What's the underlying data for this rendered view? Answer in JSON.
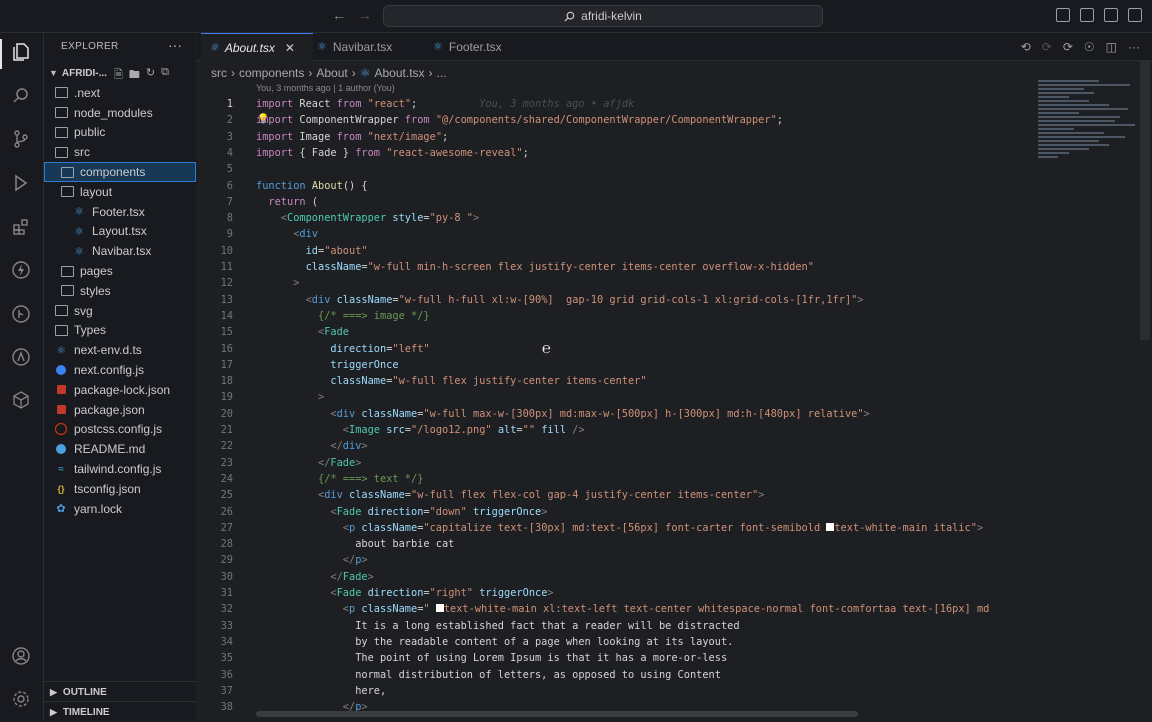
{
  "titlebar": {
    "search_text": "afridi-kelvin"
  },
  "sidebar": {
    "title": "EXPLORER",
    "more": "···",
    "root": "AFRIDI-...",
    "items": [
      {
        "label": ".next",
        "icon": "folder-icon",
        "indent": 1
      },
      {
        "label": "node_modules",
        "icon": "folder-icon",
        "indent": 1
      },
      {
        "label": "public",
        "icon": "folder-icon",
        "indent": 1
      },
      {
        "label": "src",
        "icon": "folder-icon",
        "indent": 1
      },
      {
        "label": "components",
        "icon": "folder-icon",
        "indent": 2,
        "selected": true
      },
      {
        "label": "layout",
        "icon": "folder-icon",
        "indent": 2
      },
      {
        "label": "Footer.tsx",
        "icon": "ts-file-icon",
        "indent": 3
      },
      {
        "label": "Layout.tsx",
        "icon": "ts-file-icon",
        "indent": 3
      },
      {
        "label": "Navibar.tsx",
        "icon": "ts-file-icon",
        "indent": 3
      },
      {
        "label": "pages",
        "icon": "folder-icon",
        "indent": 2
      },
      {
        "label": "styles",
        "icon": "folder-icon",
        "indent": 2
      },
      {
        "label": "svg",
        "icon": "folder-icon",
        "indent": 1
      },
      {
        "label": "Types",
        "icon": "folder-icon",
        "indent": 1
      },
      {
        "label": "next-env.d.ts",
        "icon": "ts-file-icon",
        "indent": 1
      },
      {
        "label": "next.config.js",
        "icon": "next-config-icon",
        "indent": 1
      },
      {
        "label": "package-lock.json",
        "icon": "package-icon",
        "indent": 1
      },
      {
        "label": "package.json",
        "icon": "package-icon",
        "indent": 1
      },
      {
        "label": "postcss.config.js",
        "icon": "postcss-icon",
        "indent": 1
      },
      {
        "label": "README.md",
        "icon": "info-icon",
        "indent": 1
      },
      {
        "label": "tailwind.config.js",
        "icon": "tailwind-icon",
        "indent": 1
      },
      {
        "label": "tsconfig.json",
        "icon": "json-icon",
        "indent": 1
      },
      {
        "label": "yarn.lock",
        "icon": "yarn-icon",
        "indent": 1
      }
    ],
    "outline": "OUTLINE",
    "timeline": "TIMELINE"
  },
  "tabs": [
    {
      "label": "About.tsx",
      "active": true
    },
    {
      "label": "Navibar.tsx",
      "active": false
    },
    {
      "label": "Footer.tsx",
      "active": false
    }
  ],
  "breadcrumb": [
    "src",
    "components",
    "About",
    "About.tsx",
    "..."
  ],
  "blame_header": "You, 3 months ago | 1 author (You)",
  "inline_blame": "You, 3 months ago • afjdk",
  "editor": {
    "current_line": 1,
    "lines": [
      {
        "n": 1,
        "indent": 0,
        "html": "<span class='k'>import</span> React <span class='k'>from</span> <span class='s'>\"react\"</span>;"
      },
      {
        "n": 2,
        "indent": 0,
        "html": "<span class='k'>import</span> ComponentWrapper <span class='k'>from</span> <span class='s'>\"@/components/shared/ComponentWrapper/ComponentWrapper\"</span>;"
      },
      {
        "n": 3,
        "indent": 0,
        "html": "<span class='k'>import</span> Image <span class='k'>from</span> <span class='s'>\"next/image\"</span>;"
      },
      {
        "n": 4,
        "indent": 0,
        "html": "<span class='k'>import</span> { Fade } <span class='k'>from</span> <span class='s'>\"react-awesome-reveal\"</span>;"
      },
      {
        "n": 5,
        "indent": 0,
        "html": ""
      },
      {
        "n": 6,
        "indent": 0,
        "html": "<span class='kb'>function</span> <span class='f'>About</span>() {"
      },
      {
        "n": 7,
        "indent": 2,
        "html": "<span class='k'>return</span> ("
      },
      {
        "n": 8,
        "indent": 4,
        "html": "<span class='p'>&lt;</span><span class='t'>ComponentWrapper</span> <span class='a'>style</span>=<span class='s'>\"py-8 \"</span><span class='p'>&gt;</span>"
      },
      {
        "n": 9,
        "indent": 6,
        "html": "<span class='p'>&lt;</span><span class='kb'>div</span>"
      },
      {
        "n": 10,
        "indent": 8,
        "html": "<span class='a'>id</span>=<span class='s'>\"about\"</span>"
      },
      {
        "n": 11,
        "indent": 8,
        "html": "<span class='a'>className</span>=<span class='s'>\"w-full min-h-screen flex justify-center items-center overflow-x-hidden\"</span>"
      },
      {
        "n": 12,
        "indent": 6,
        "html": "<span class='p'>&gt;</span>"
      },
      {
        "n": 13,
        "indent": 8,
        "html": "<span class='p'>&lt;</span><span class='kb'>div</span> <span class='a'>className</span>=<span class='s'>\"w-full h-full xl:w-[90%]  gap-10 grid grid-cols-1 xl:grid-cols-[1fr,1fr]\"</span><span class='p'>&gt;</span>"
      },
      {
        "n": 14,
        "indent": 10,
        "html": "<span class='c'>{/* ===&gt; image */}</span>"
      },
      {
        "n": 15,
        "indent": 10,
        "html": "<span class='p'>&lt;</span><span class='t'>Fade</span>"
      },
      {
        "n": 16,
        "indent": 12,
        "html": "<span class='a'>direction</span>=<span class='s'>\"left\"</span>"
      },
      {
        "n": 17,
        "indent": 12,
        "html": "<span class='a'>triggerOnce</span>"
      },
      {
        "n": 18,
        "indent": 12,
        "html": "<span class='a'>className</span>=<span class='s'>\"w-full flex justify-center items-center\"</span>"
      },
      {
        "n": 19,
        "indent": 10,
        "html": "<span class='p'>&gt;</span>"
      },
      {
        "n": 20,
        "indent": 12,
        "html": "<span class='p'>&lt;</span><span class='kb'>div</span> <span class='a'>className</span>=<span class='s'>\"w-full max-w-[300px] md:max-w-[500px] h-[300px] md:h-[480px] relative\"</span><span class='p'>&gt;</span>"
      },
      {
        "n": 21,
        "indent": 14,
        "html": "<span class='p'>&lt;</span><span class='t'>Image</span> <span class='a'>src</span>=<span class='s'>\"/logo12.png\"</span> <span class='a'>alt</span>=<span class='s'>\"\"</span> <span class='a'>fill</span> <span class='p'>/&gt;</span>"
      },
      {
        "n": 22,
        "indent": 12,
        "html": "<span class='p'>&lt;/</span><span class='kb'>div</span><span class='p'>&gt;</span>"
      },
      {
        "n": 23,
        "indent": 10,
        "html": "<span class='p'>&lt;/</span><span class='t'>Fade</span><span class='p'>&gt;</span>"
      },
      {
        "n": 24,
        "indent": 10,
        "html": "<span class='c'>{/* ===&gt; text */}</span>"
      },
      {
        "n": 25,
        "indent": 10,
        "html": "<span class='p'>&lt;</span><span class='kb'>div</span> <span class='a'>className</span>=<span class='s'>\"w-full flex flex-col gap-4 justify-center items-center\"</span><span class='p'>&gt;</span>"
      },
      {
        "n": 26,
        "indent": 12,
        "html": "<span class='p'>&lt;</span><span class='t'>Fade</span> <span class='a'>direction</span>=<span class='s'>\"down\"</span> <span class='a'>triggerOnce</span><span class='p'>&gt;</span>"
      },
      {
        "n": 27,
        "indent": 14,
        "html": "<span class='p'>&lt;</span><span class='kb'>p</span> <span class='a'>className</span>=<span class='s'>\"capitalize text-[30px] md:text-[56px] font-carter font-semibold </span><span style='display:inline-block;width:8px;height:8px;background:#fff;'></span><span class='s'>text-white-main italic\"</span><span class='p'>&gt;</span>"
      },
      {
        "n": 28,
        "indent": 16,
        "html": "about barbie cat"
      },
      {
        "n": 29,
        "indent": 14,
        "html": "<span class='p'>&lt;/</span><span class='kb'>p</span><span class='p'>&gt;</span>"
      },
      {
        "n": 30,
        "indent": 12,
        "html": "<span class='p'>&lt;/</span><span class='t'>Fade</span><span class='p'>&gt;</span>"
      },
      {
        "n": 31,
        "indent": 12,
        "html": "<span class='p'>&lt;</span><span class='t'>Fade</span> <span class='a'>direction</span>=<span class='s'>\"right\"</span> <span class='a'>triggerOnce</span><span class='p'>&gt;</span>"
      },
      {
        "n": 32,
        "indent": 14,
        "html": "<span class='p'>&lt;</span><span class='kb'>p</span> <span class='a'>className</span>=<span class='s'>\" </span><span style='display:inline-block;width:8px;height:8px;background:#fff;'></span><span class='s'>text-white-main xl:text-left text-center whitespace-normal font-comfortaa text-[16px] md</span>"
      },
      {
        "n": 33,
        "indent": 16,
        "html": "It is a long established fact that a reader will be distracted"
      },
      {
        "n": 34,
        "indent": 16,
        "html": "by the readable content of a page when looking at its layout."
      },
      {
        "n": 35,
        "indent": 16,
        "html": "The point of using Lorem Ipsum is that it has a more-or-less"
      },
      {
        "n": 36,
        "indent": 16,
        "html": "normal distribution of letters, as opposed to using Content"
      },
      {
        "n": 37,
        "indent": 16,
        "html": "here,"
      },
      {
        "n": 38,
        "indent": 14,
        "html": "<span class='p'>&lt;/</span><span class='kb'>p</span><span class='p'>&gt;</span>"
      }
    ]
  }
}
